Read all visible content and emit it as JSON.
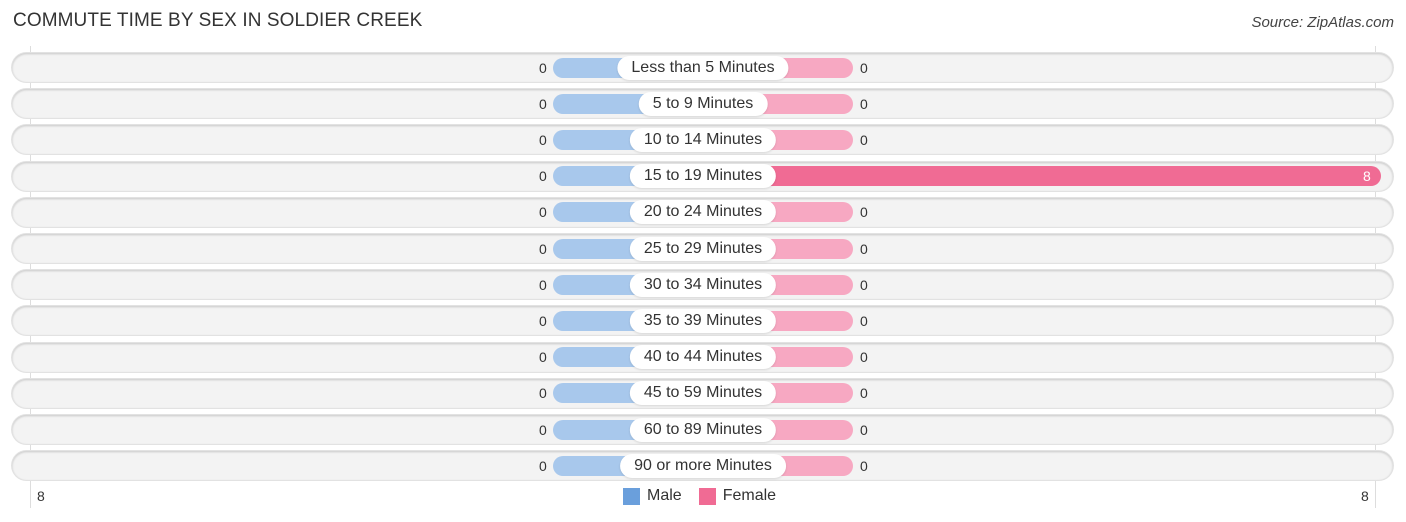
{
  "title": "COMMUTE TIME BY SEX IN SOLDIER CREEK",
  "source": "Source: ZipAtlas.com",
  "colors": {
    "male": "#a8c8ec",
    "female": "#f7a8c2",
    "female_highlight": "#f06b94",
    "male_legend": "#6a9fdc",
    "female_legend": "#f06b94"
  },
  "legend": {
    "male": "Male",
    "female": "Female"
  },
  "axis": {
    "left_tick": "8",
    "right_tick": "8"
  },
  "chart_data": {
    "type": "bar",
    "orientation": "horizontal-diverging",
    "title": "COMMUTE TIME BY SEX IN SOLDIER CREEK",
    "categories": [
      "Less than 5 Minutes",
      "5 to 9 Minutes",
      "10 to 14 Minutes",
      "15 to 19 Minutes",
      "20 to 24 Minutes",
      "25 to 29 Minutes",
      "30 to 34 Minutes",
      "35 to 39 Minutes",
      "40 to 44 Minutes",
      "45 to 59 Minutes",
      "60 to 89 Minutes",
      "90 or more Minutes"
    ],
    "series": [
      {
        "name": "Male",
        "values": [
          0,
          0,
          0,
          0,
          0,
          0,
          0,
          0,
          0,
          0,
          0,
          0
        ]
      },
      {
        "name": "Female",
        "values": [
          0,
          0,
          0,
          8,
          0,
          0,
          0,
          0,
          0,
          0,
          0,
          0
        ]
      }
    ],
    "xlim": [
      -8,
      8
    ],
    "xtick_labels": [
      "8",
      "8"
    ],
    "legend": [
      "Male",
      "Female"
    ],
    "legend_position": "bottom-center",
    "grid": false
  }
}
